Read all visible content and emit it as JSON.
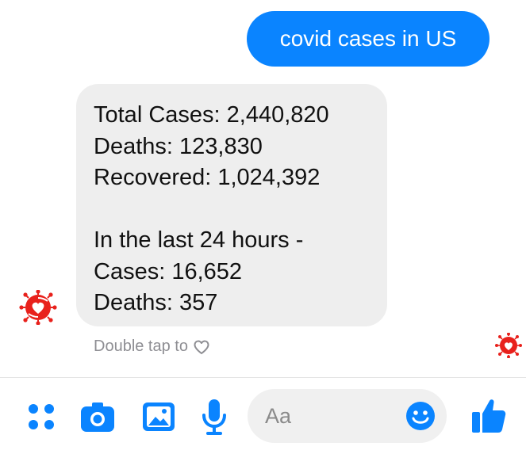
{
  "conversation": {
    "outgoing_message": "covid cases in US",
    "incoming_message": {
      "lines": [
        "Total Cases: 2,440,820",
        "Deaths: 123,830",
        "Recovered: 1,024,392",
        "",
        "In the last 24 hours -",
        "Cases: 16,652",
        "Deaths: 357"
      ]
    },
    "reaction_hint": "Double tap to"
  },
  "composer": {
    "placeholder": "Aa"
  },
  "colors": {
    "accent": "#0a84ff",
    "incoming_bubble": "#eeeeee",
    "avatar_red": "#e8211c"
  },
  "icons": {
    "avatar": "virus-heart-logo-icon",
    "reaction": "heart-outline-icon",
    "toolbar": [
      "menu-dots-icon",
      "camera-icon",
      "image-icon",
      "microphone-icon",
      "emoji-icon",
      "thumbs-up-icon"
    ]
  }
}
